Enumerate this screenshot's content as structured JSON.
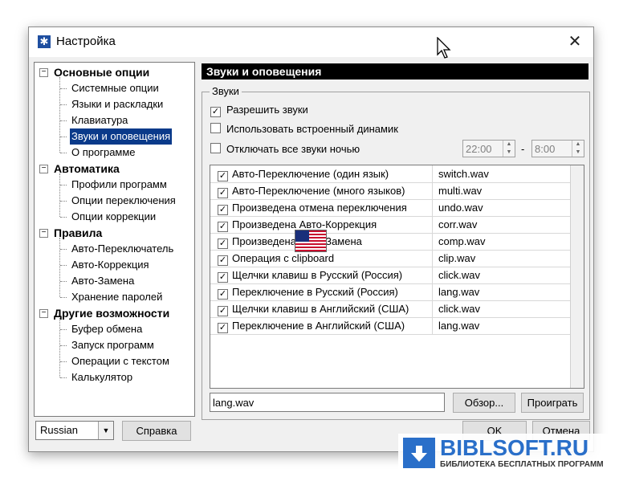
{
  "window": {
    "title": "Настройка",
    "close_glyph": "✕",
    "app_icon": "settings-app-icon"
  },
  "tree": {
    "groups": [
      {
        "label": "Основные опции",
        "expander": "−",
        "items": [
          "Системные опции",
          "Языки и раскладки",
          "Клавиатура",
          "Звуки и оповещения",
          "О программе"
        ]
      },
      {
        "label": "Автоматика",
        "expander": "−",
        "items": [
          "Профили программ",
          "Опции переключения",
          "Опции коррекции"
        ]
      },
      {
        "label": "Правила",
        "expander": "−",
        "items": [
          "Авто-Переключатель",
          "Авто-Коррекция",
          "Авто-Замена",
          "Хранение паролей"
        ]
      },
      {
        "label": "Другие возможности",
        "expander": "−",
        "items": [
          "Буфер обмена",
          "Запуск программ",
          "Операции с текстом",
          "Калькулятор"
        ]
      }
    ],
    "selected": "Звуки и оповещения"
  },
  "panel": {
    "header": "Звуки и оповещения",
    "group_label": "Звуки",
    "options": [
      {
        "label": "Разрешить звуки",
        "checked": true
      },
      {
        "label": "Использовать встроенный динамик",
        "checked": false
      },
      {
        "label": "Отключать все звуки ночью",
        "checked": false
      }
    ],
    "night_from": "22:00",
    "night_sep": "-",
    "night_to": "8:00",
    "sounds": [
      {
        "event": "Авто-Переключение (один язык)",
        "file": "switch.wav",
        "checked": true
      },
      {
        "event": "Авто-Переключение (много языков)",
        "file": "multi.wav",
        "checked": true
      },
      {
        "event": "Произведена отмена переключения",
        "file": "undo.wav",
        "checked": true
      },
      {
        "event": "Произведена Авто-Коррекция",
        "file": "corr.wav",
        "checked": true
      },
      {
        "event": "Произведена Авто-Замена",
        "file": "comp.wav",
        "checked": true
      },
      {
        "event": "Операция с clipboard",
        "file": "clip.wav",
        "checked": true
      },
      {
        "event": "Щелчки клавиш в Русский (Россия)",
        "file": "click.wav",
        "checked": true
      },
      {
        "event": "Переключение в Русский (Россия)",
        "file": "lang.wav",
        "checked": true
      },
      {
        "event": "Щелчки клавиш в Английский (США)",
        "file": "click.wav",
        "checked": true
      },
      {
        "event": "Переключение в Английский (США)",
        "file": "lang.wav",
        "checked": true
      }
    ],
    "file_value": "lang.wav",
    "browse_label": "Обзор...",
    "play_label": "Проиграть"
  },
  "footer": {
    "language": "Russian",
    "help_label": "Справка",
    "ok_label": "OK",
    "cancel_label": "Отмена"
  },
  "watermark": {
    "brand": "BIBLSOFT.RU",
    "subtitle": "БИБЛИОТЕКА БЕСПЛАТНЫХ ПРОГРАММ"
  },
  "colors": {
    "selection": "#0a3a8a",
    "header_bg": "#000000",
    "brand": "#2a6fc9"
  }
}
